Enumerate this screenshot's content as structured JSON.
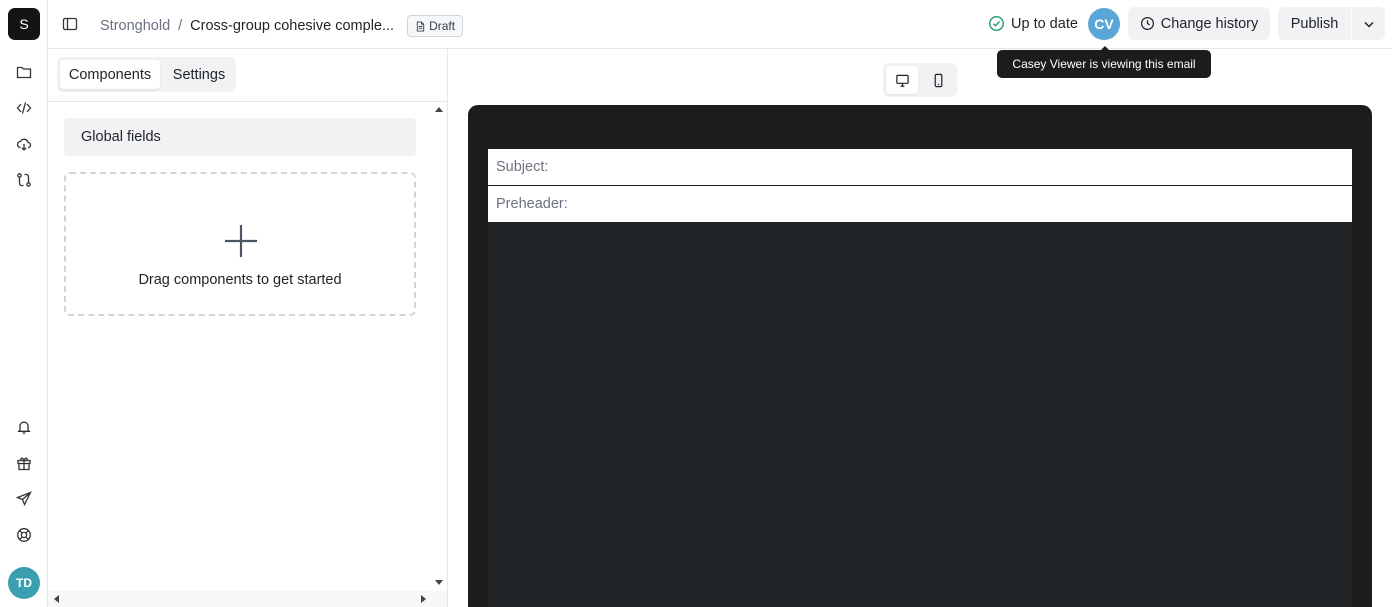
{
  "rail": {
    "logo": "S",
    "top_icons": [
      "folder-icon",
      "code-icon",
      "cloud-download-icon",
      "route-icon"
    ],
    "bottom_icons": [
      "bell-icon",
      "gift-icon",
      "send-icon",
      "help-buoy-icon"
    ],
    "user_initials": "TD"
  },
  "header": {
    "breadcrumb_root": "Stronghold",
    "breadcrumb_separator": "/",
    "breadcrumb_current": "Cross-group cohesive comple...",
    "draft_badge": "Draft",
    "status_text": "Up to date",
    "viewer_initials": "CV",
    "change_history_label": "Change history",
    "publish_label": "Publish",
    "tooltip": "Casey Viewer is viewing this email"
  },
  "panel": {
    "tabs": [
      {
        "label": "Components",
        "active": true
      },
      {
        "label": "Settings",
        "active": false
      }
    ],
    "global_fields_label": "Global fields",
    "dropzone_text": "Drag components to get started"
  },
  "preview": {
    "devices": [
      {
        "name": "desktop",
        "active": true
      },
      {
        "name": "mobile",
        "active": false
      }
    ],
    "subject_label": "Subject:",
    "preheader_label": "Preheader:"
  },
  "colors": {
    "status_ok": "#22a06b",
    "viewer_avatar": "#5aa6d6",
    "user_avatar": "#3a9fb0",
    "preview_frame": "#1c1c1c",
    "email_canvas": "#212426"
  }
}
